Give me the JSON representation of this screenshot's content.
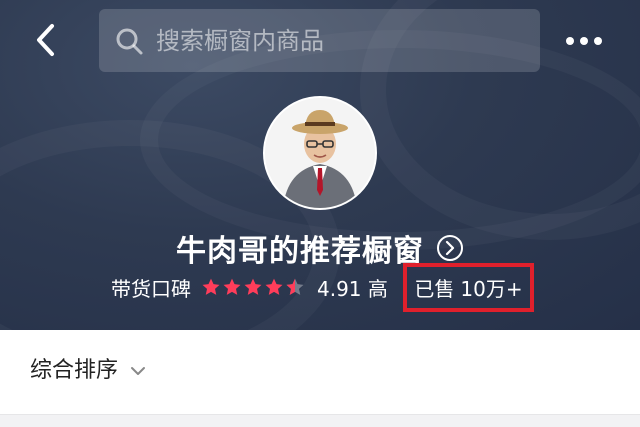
{
  "search": {
    "placeholder": "搜索橱窗内商品",
    "icon": "search-icon"
  },
  "header": {
    "back_icon": "back-chevron-icon",
    "more_icon": "more-dots-icon"
  },
  "shop": {
    "name": "牛肉哥的推荐橱窗",
    "rating_label": "带货口碑",
    "stars": 4.5,
    "score_text": "4.91 高",
    "sold_label": "已售",
    "sold_value": "10万+"
  },
  "sort": {
    "label": "综合排序"
  },
  "colors": {
    "hero_bg": "#2e3a51",
    "star": "#ff3d5a",
    "highlight_border": "#e0202c"
  }
}
